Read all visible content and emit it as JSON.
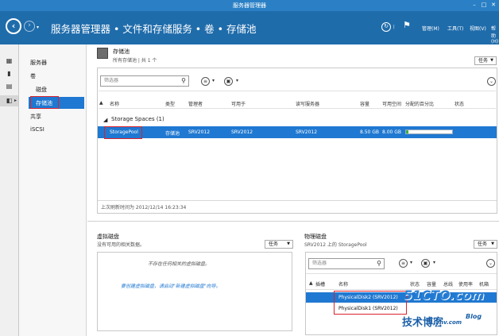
{
  "window": {
    "title": "服务器管理器",
    "min": "–",
    "max": "□",
    "close": "✕"
  },
  "header": {
    "breadcrumb": "服务器管理器 • 文件和存储服务 • 卷 • 存储池",
    "menus": [
      "管理(M)",
      "工具(T)",
      "视图(V)",
      "帮助(H)"
    ]
  },
  "nav": {
    "items": [
      "服务器",
      "卷",
      "磁盘",
      "存储池",
      "共享",
      "iSCSI"
    ]
  },
  "pool_pane": {
    "title": "存储池",
    "subtitle": "所有存储池 | 共 1 个",
    "tasks": "任务",
    "filter_placeholder": "筛选器",
    "columns": [
      "名称",
      "类型",
      "管理者",
      "可用于",
      "读写服务器",
      "容量",
      "可用空间",
      "分配的百分比",
      "状态"
    ],
    "group": "Storage Spaces (1)",
    "rows": [
      {
        "name": "StoragePool",
        "type": "存储池",
        "managed_by": "SRV2012",
        "available_to": "SRV2012",
        "rw_server": "SRV2012",
        "capacity": "8.50 GB",
        "free": "8.00 GB",
        "allocated_pct": 6
      }
    ],
    "last_refresh": "上次刷新时间为 2012/12/14 16:23:34"
  },
  "vdisk_pane": {
    "title": "虚拟磁盘",
    "subtitle": "没有可用的相关数据。",
    "tasks": "任务",
    "empty_msg": "不存在任何相关的虚拟磁盘。",
    "create_link": "要创建虚拟磁盘，请启动\"新建虚拟磁盘\"向导。"
  },
  "pdisk_pane": {
    "title": "物理磁盘",
    "subtitle": "SRV2012 上的 StoragePool",
    "tasks": "任务",
    "filter_placeholder": "筛选器",
    "columns": [
      "插槽",
      "名称",
      "状态",
      "容量",
      "总线",
      "使用率",
      "机箱"
    ],
    "rows": [
      {
        "name": "PhysicalDisk2 (SRV2012)"
      },
      {
        "name": "PhysicalDisk1 (SRV2012)"
      }
    ]
  },
  "watermark": {
    "site": "51CTO.com",
    "tagline": "技术博客",
    "blog": "Blog",
    "url": "Jyhv.com"
  },
  "colors": {
    "title_bar": "#2b80c5",
    "header": "#1f6cab",
    "selection": "#1f78d1",
    "highlight_box": "#d9232d"
  }
}
